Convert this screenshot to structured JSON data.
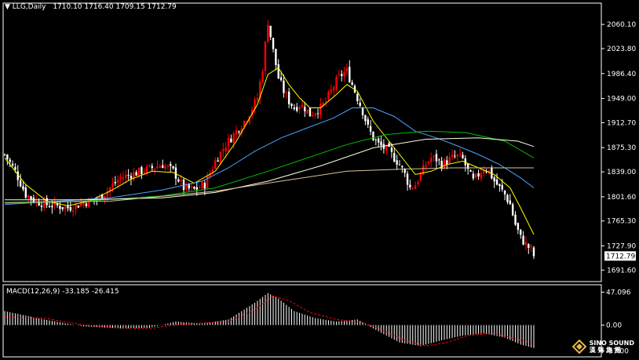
{
  "header": {
    "symbol": "LLG,Daily",
    "ohlc": "1710.10 1716.40 1709.15 1712.79",
    "indicator": "MACD(12,26,9) -33.185 -26.415"
  },
  "colors": {
    "background": "#000000",
    "axis": "#ffffff",
    "candle_up": "#ff0000",
    "candle_down": "#ffffff",
    "ma_short": "#ffff00",
    "ma_mid": "#4aa3ff",
    "ma_mid2": "#00c000",
    "ma_long": "#ffffe0",
    "ma_longest": "#d8c39a",
    "macd_hist": "#ffffff",
    "macd_signal": "#ff0000",
    "price_label_bg": "#ffffff"
  },
  "chart_data": [
    {
      "type": "candlestick",
      "title": "LLG,Daily",
      "y_ticks": [
        2060.1,
        2023.8,
        1986.4,
        1949.0,
        1912.7,
        1875.3,
        1839.0,
        1801.6,
        1765.3,
        1727.9,
        1691.6
      ],
      "last_price": "1712.79",
      "ylim": [
        1685,
        2085
      ],
      "series_names": [
        "MA short",
        "MA mid",
        "MA mid2",
        "MA long",
        "MA longest"
      ],
      "close_path": [
        [
          0,
          1865
        ],
        [
          4,
          1840
        ],
        [
          8,
          1805
        ],
        [
          12,
          1795
        ],
        [
          16,
          1790
        ],
        [
          20,
          1788
        ],
        [
          24,
          1785
        ],
        [
          28,
          1790
        ],
        [
          32,
          1795
        ],
        [
          36,
          1800
        ],
        [
          40,
          1815
        ],
        [
          44,
          1830
        ],
        [
          48,
          1835
        ],
        [
          52,
          1840
        ],
        [
          56,
          1845
        ],
        [
          60,
          1850
        ],
        [
          64,
          1840
        ],
        [
          68,
          1815
        ],
        [
          72,
          1812
        ],
        [
          76,
          1820
        ],
        [
          80,
          1855
        ],
        [
          84,
          1880
        ],
        [
          88,
          1900
        ],
        [
          92,
          1920
        ],
        [
          96,
          1950
        ],
        [
          98,
          1995
        ],
        [
          100,
          2065
        ],
        [
          102,
          2020
        ],
        [
          104,
          1980
        ],
        [
          106,
          1960
        ],
        [
          108,
          1945
        ],
        [
          110,
          1935
        ],
        [
          112,
          1940
        ],
        [
          114,
          1935
        ],
        [
          116,
          1925
        ],
        [
          118,
          1930
        ],
        [
          120,
          1935
        ],
        [
          122,
          1945
        ],
        [
          124,
          1960
        ],
        [
          126,
          1975
        ],
        [
          128,
          1985
        ],
        [
          130,
          1990
        ],
        [
          132,
          1970
        ],
        [
          134,
          1950
        ],
        [
          136,
          1930
        ],
        [
          138,
          1905
        ],
        [
          140,
          1890
        ],
        [
          142,
          1880
        ],
        [
          144,
          1875
        ],
        [
          146,
          1870
        ],
        [
          148,
          1860
        ],
        [
          150,
          1850
        ],
        [
          152,
          1835
        ],
        [
          154,
          1815
        ],
        [
          156,
          1820
        ],
        [
          158,
          1835
        ],
        [
          160,
          1850
        ],
        [
          162,
          1860
        ],
        [
          164,
          1858
        ],
        [
          166,
          1850
        ],
        [
          168,
          1855
        ],
        [
          170,
          1860
        ],
        [
          172,
          1862
        ],
        [
          174,
          1858
        ],
        [
          176,
          1840
        ],
        [
          178,
          1825
        ],
        [
          180,
          1835
        ],
        [
          182,
          1845
        ],
        [
          184,
          1840
        ],
        [
          186,
          1825
        ],
        [
          188,
          1815
        ],
        [
          190,
          1805
        ],
        [
          192,
          1790
        ],
        [
          194,
          1760
        ],
        [
          196,
          1740
        ],
        [
          198,
          1730
        ],
        [
          200,
          1722
        ],
        [
          201,
          1713
        ]
      ],
      "ma_lines": [
        {
          "name": "MA short",
          "points": [
            [
              0,
              1860
            ],
            [
              8,
              1820
            ],
            [
              16,
              1795
            ],
            [
              24,
              1788
            ],
            [
              32,
              1795
            ],
            [
              40,
              1810
            ],
            [
              48,
              1828
            ],
            [
              56,
              1840
            ],
            [
              64,
              1838
            ],
            [
              72,
              1822
            ],
            [
              80,
              1840
            ],
            [
              88,
              1885
            ],
            [
              96,
              1940
            ],
            [
              100,
              1985
            ],
            [
              104,
              1995
            ],
            [
              108,
              1970
            ],
            [
              112,
              1950
            ],
            [
              116,
              1935
            ],
            [
              120,
              1935
            ],
            [
              126,
              1955
            ],
            [
              130,
              1970
            ],
            [
              134,
              1960
            ],
            [
              140,
              1915
            ],
            [
              146,
              1885
            ],
            [
              152,
              1855
            ],
            [
              156,
              1835
            ],
            [
              162,
              1840
            ],
            [
              168,
              1850
            ],
            [
              174,
              1855
            ],
            [
              180,
              1845
            ],
            [
              186,
              1835
            ],
            [
              192,
              1815
            ],
            [
              196,
              1785
            ],
            [
              201,
              1745
            ]
          ]
        },
        {
          "name": "MA mid",
          "points": [
            [
              0,
              1790
            ],
            [
              20,
              1795
            ],
            [
              40,
              1800
            ],
            [
              60,
              1812
            ],
            [
              75,
              1825
            ],
            [
              85,
              1845
            ],
            [
              95,
              1870
            ],
            [
              105,
              1890
            ],
            [
              115,
              1905
            ],
            [
              125,
              1920
            ],
            [
              132,
              1935
            ],
            [
              140,
              1935
            ],
            [
              148,
              1922
            ],
            [
              156,
              1900
            ],
            [
              164,
              1890
            ],
            [
              172,
              1878
            ],
            [
              180,
              1865
            ],
            [
              188,
              1850
            ],
            [
              196,
              1830
            ],
            [
              201,
              1815
            ]
          ]
        },
        {
          "name": "MA mid2",
          "points": [
            [
              0,
              1792
            ],
            [
              30,
              1795
            ],
            [
              60,
              1803
            ],
            [
              80,
              1815
            ],
            [
              100,
              1840
            ],
            [
              115,
              1860
            ],
            [
              130,
              1880
            ],
            [
              145,
              1895
            ],
            [
              160,
              1900
            ],
            [
              175,
              1898
            ],
            [
              190,
              1885
            ],
            [
              201,
              1860
            ]
          ]
        },
        {
          "name": "MA long",
          "points": [
            [
              0,
              1797
            ],
            [
              30,
              1797
            ],
            [
              60,
              1800
            ],
            [
              80,
              1808
            ],
            [
              100,
              1825
            ],
            [
              120,
              1848
            ],
            [
              140,
              1875
            ],
            [
              160,
              1888
            ],
            [
              180,
              1890
            ],
            [
              195,
              1885
            ],
            [
              201,
              1877
            ]
          ]
        },
        {
          "name": "MA longest",
          "points": [
            [
              0,
              1793
            ],
            [
              40,
              1795
            ],
            [
              80,
              1810
            ],
            [
              110,
              1828
            ],
            [
              130,
              1840
            ],
            [
              150,
              1843
            ],
            [
              170,
              1845
            ],
            [
              190,
              1845
            ],
            [
              201,
              1845
            ]
          ]
        }
      ]
    },
    {
      "type": "bar",
      "title": "MACD(12,26,9) -33.185 -26.415",
      "y_ticks": [
        47.096,
        0.0,
        -37.0
      ],
      "ylim": [
        -40,
        50
      ],
      "series_names": [
        "MACD",
        "Signal"
      ],
      "macd_path": [
        [
          0,
          20
        ],
        [
          15,
          8
        ],
        [
          30,
          -2
        ],
        [
          45,
          -5
        ],
        [
          55,
          -4
        ],
        [
          65,
          5
        ],
        [
          75,
          2
        ],
        [
          85,
          8
        ],
        [
          95,
          32
        ],
        [
          100,
          46
        ],
        [
          104,
          38
        ],
        [
          110,
          20
        ],
        [
          118,
          10
        ],
        [
          126,
          5
        ],
        [
          134,
          8
        ],
        [
          140,
          -5
        ],
        [
          150,
          -25
        ],
        [
          158,
          -30
        ],
        [
          166,
          -22
        ],
        [
          174,
          -15
        ],
        [
          182,
          -12
        ],
        [
          190,
          -18
        ],
        [
          196,
          -28
        ],
        [
          201,
          -33
        ]
      ],
      "signal_path": [
        [
          0,
          12
        ],
        [
          15,
          10
        ],
        [
          30,
          0
        ],
        [
          45,
          -4
        ],
        [
          55,
          -5
        ],
        [
          65,
          0
        ],
        [
          75,
          3
        ],
        [
          85,
          5
        ],
        [
          95,
          22
        ],
        [
          102,
          42
        ],
        [
          108,
          35
        ],
        [
          116,
          18
        ],
        [
          126,
          8
        ],
        [
          136,
          4
        ],
        [
          144,
          -8
        ],
        [
          152,
          -22
        ],
        [
          160,
          -30
        ],
        [
          168,
          -25
        ],
        [
          176,
          -15
        ],
        [
          186,
          -12
        ],
        [
          194,
          -20
        ],
        [
          201,
          -26
        ]
      ]
    }
  ],
  "watermark": {
    "line1": "SINO SOUND",
    "line2": "漢 聲 集 團"
  }
}
